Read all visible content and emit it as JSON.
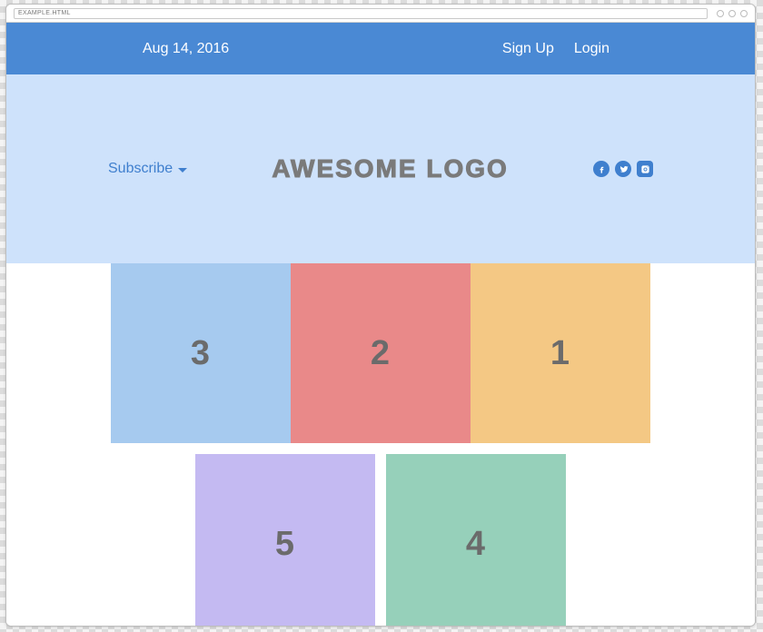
{
  "browser": {
    "address": "EXAMPLE.HTML"
  },
  "topbar": {
    "date": "Aug 14, 2016",
    "signup": "Sign Up",
    "login": "Login"
  },
  "hero": {
    "subscribe": "Subscribe",
    "logo": "AWESOME LOGO"
  },
  "social": {
    "facebook": "f",
    "twitter": "t",
    "instagram": "i"
  },
  "tiles": {
    "row1": [
      {
        "label": "3",
        "color": "#a6caef"
      },
      {
        "label": "2",
        "color": "#e98989"
      },
      {
        "label": "1",
        "color": "#f4c884"
      }
    ],
    "row2": [
      {
        "label": "5",
        "color": "#c4baf2"
      },
      {
        "label": "4",
        "color": "#96d0ba"
      }
    ]
  }
}
